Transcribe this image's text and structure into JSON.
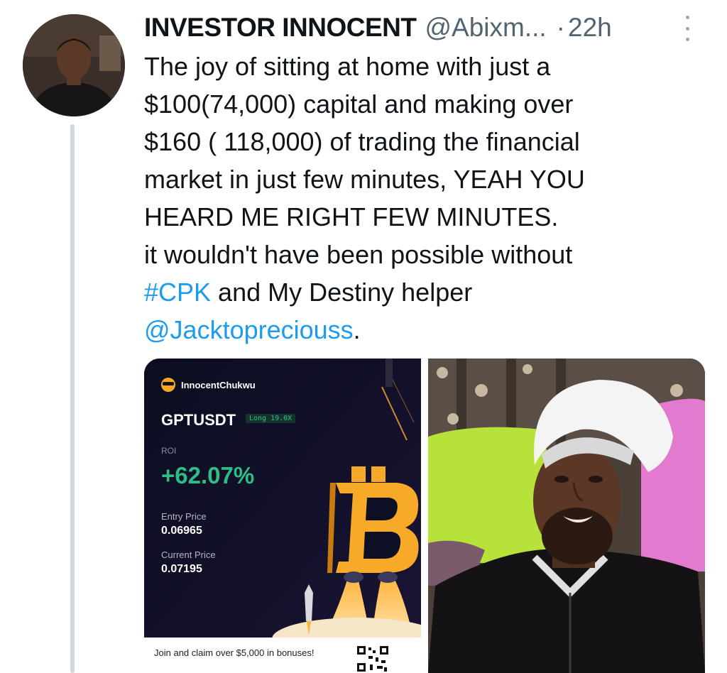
{
  "tweet": {
    "display_name": "INVESTOR INNOCENT",
    "handle": "@Abixm...",
    "separator": "·",
    "time": "22h",
    "more_icon": "more-vertical-icon",
    "text_lines": [
      "The joy of sitting at home with just a",
      "$100(74,000) capital and making over",
      "$160 ( 118,000) of trading the financial",
      "market in just few minutes, YEAH YOU",
      "HEARD ME RIGHT FEW MINUTES.",
      "it wouldn't have been possible without"
    ],
    "hashtag": "#CPK",
    "text_after_hashtag": " and My Destiny helper",
    "mention": "@Jacktopreciouss",
    "text_end": "."
  },
  "trade_card": {
    "username": "InnocentChukwu",
    "pair": "GPTUSDT",
    "position_tag": "Long 19.0X",
    "roi_label": "ROI",
    "roi_value": "+62.07%",
    "entry_label": "Entry Price",
    "entry_value": "0.06965",
    "current_label": "Current Price",
    "current_value": "0.07195",
    "promo_text": "Join and claim over $5,000 in bonuses!",
    "accent_green": "#2ebd85",
    "bitcoin_orange": "#f7a928"
  },
  "colors": {
    "link": "#1d9bf0",
    "secondary_text": "#536471",
    "thread_line": "#cfd9de"
  }
}
